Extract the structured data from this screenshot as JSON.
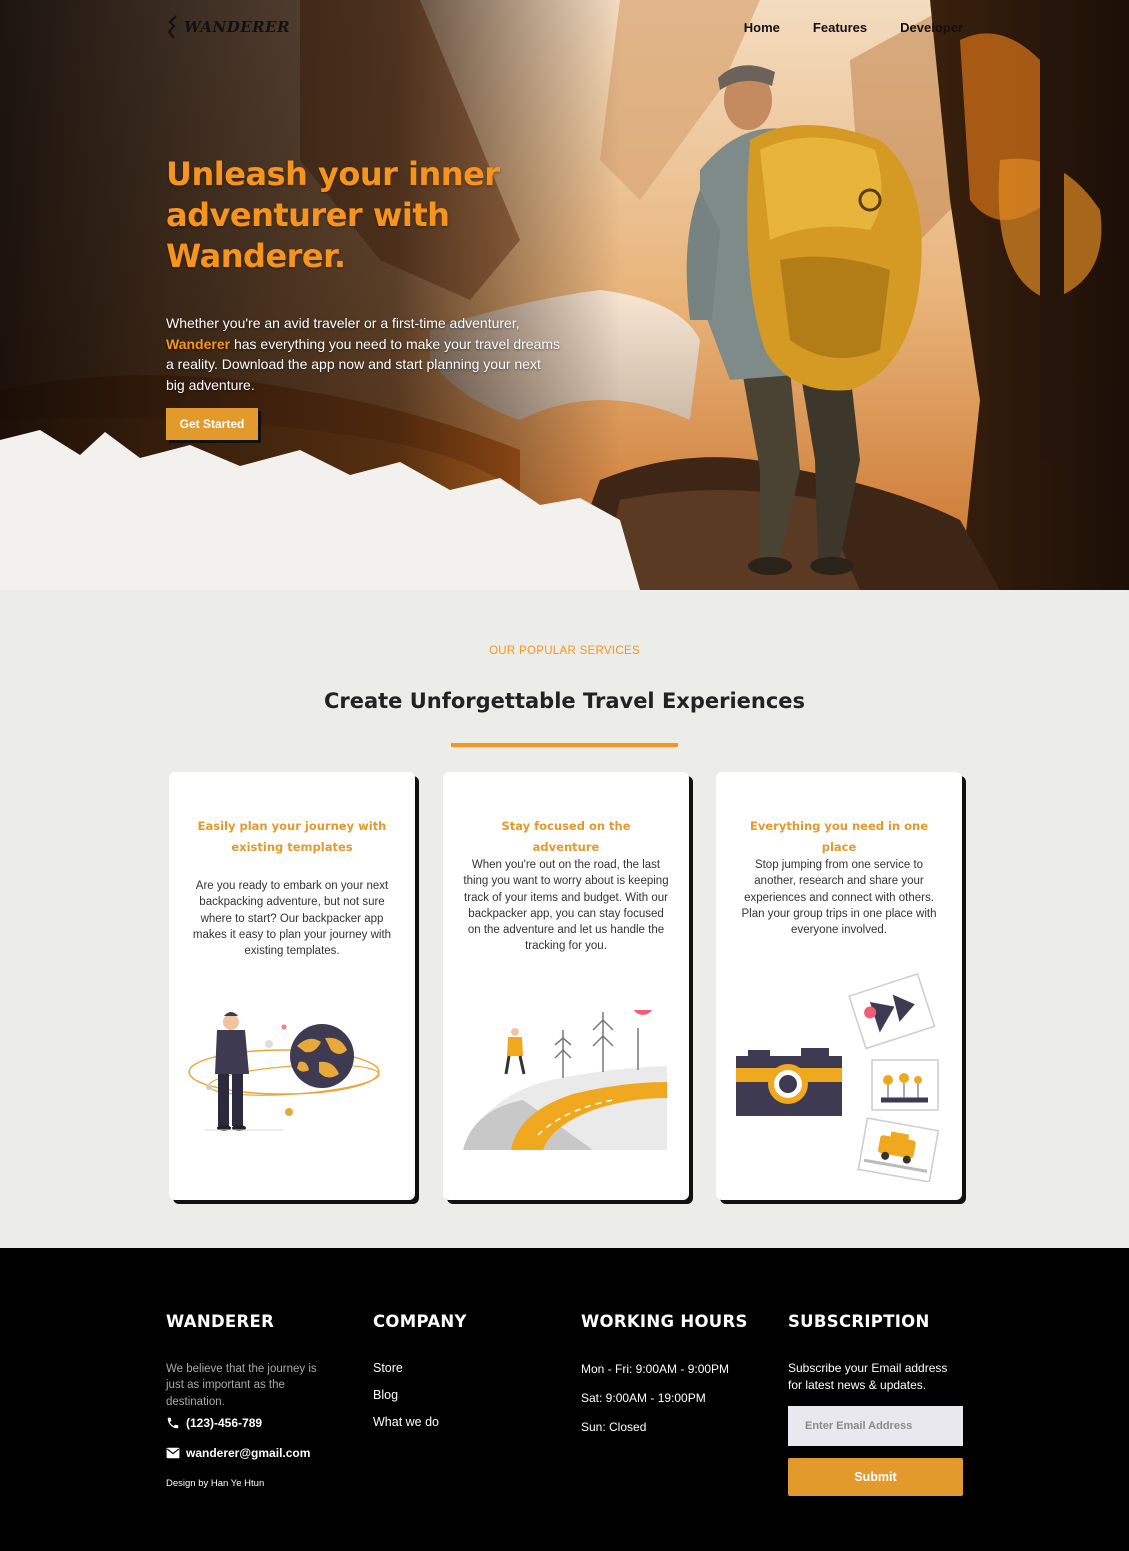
{
  "nav": {
    "logo": "WANDERER",
    "links": [
      "Home",
      "Features",
      "Developer"
    ]
  },
  "hero": {
    "title": "Unleash your inner adventurer with Wanderer.",
    "desc_prefix": "Whether you're an avid traveler or a first-time adventurer, ",
    "desc_brand": "Wanderer",
    "desc_suffix": " has everything you need to make your travel dreams a reality. Download the app now and start planning your next big adventure.",
    "cta": "Get Started"
  },
  "services": {
    "eyebrow": "OUR POPULAR SERVICES",
    "title": "Create Unforgettable Travel Experiences",
    "cards": [
      {
        "title": "Easily plan your journey with existing templates",
        "body": "Are you ready to embark on your next backpacking adventure, but not sure where to start? Our backpacker app makes it easy to plan your journey with existing templates."
      },
      {
        "title": "Stay focused on the adventure",
        "body": "When you're out on the road, the last thing you want to worry about is keeping track of your items and budget. With our backpacker app, you can stay focused on the adventure and let us handle the tracking for you."
      },
      {
        "title": "Everything you need in one place",
        "body": "Stop jumping from one service to another, research and share your experiences and connect with others. Plan your group trips in one place with everyone involved."
      }
    ]
  },
  "footer": {
    "brand": {
      "heading": "WANDERER",
      "about": "We believe that the journey is just as important as the destination.",
      "phone": "(123)-456-789",
      "email": "wanderer@gmail.com",
      "credit": "Design by Han Ye Htun"
    },
    "company": {
      "heading": "COMPANY",
      "links": [
        "Store",
        "Blog",
        "What we do"
      ]
    },
    "hours": {
      "heading": "WORKING HOURS",
      "lines": [
        "Mon - Fri: 9:00AM - 9:00PM",
        "Sat: 9:00AM - 19:00PM",
        "Sun: Closed"
      ]
    },
    "subscription": {
      "heading": "SUBSCRIPTION",
      "text": "Subscribe your Email address for latest news & updates.",
      "placeholder": "Enter Email Address",
      "button": "Submit"
    }
  },
  "colors": {
    "accent": "#f7941d",
    "button": "#e39a2c",
    "footer_bg": "#000000",
    "section_bg": "#ecece8"
  }
}
